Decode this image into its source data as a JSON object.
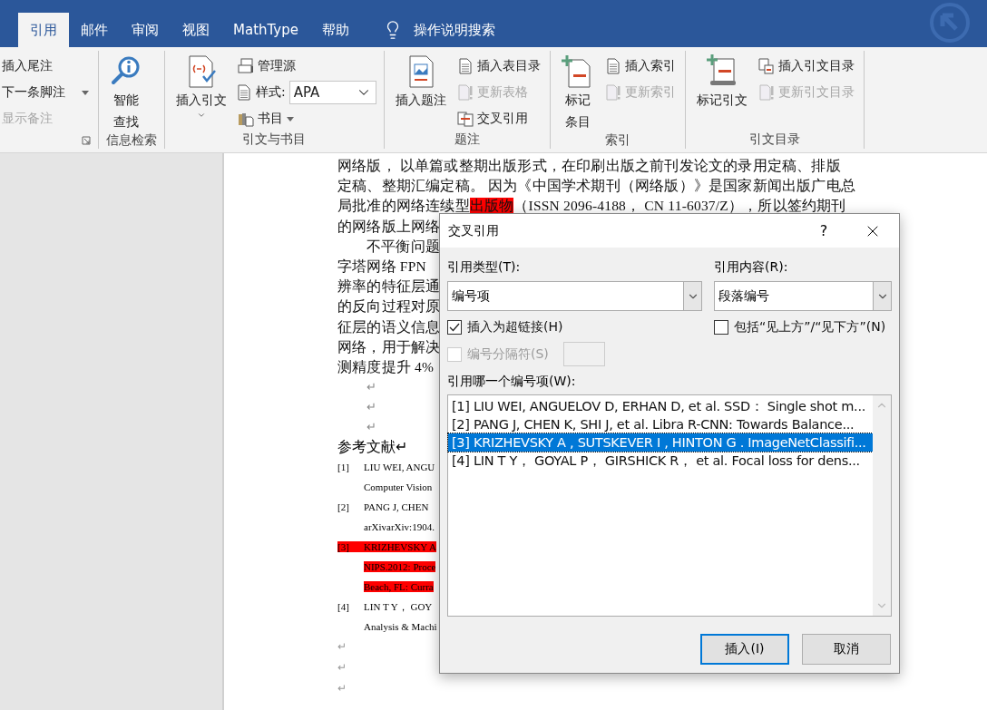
{
  "ribbon_tabs": [
    {
      "label": "引用",
      "selected": true
    },
    {
      "label": "邮件",
      "selected": false
    },
    {
      "label": "审阅",
      "selected": false
    },
    {
      "label": "视图",
      "selected": false
    },
    {
      "label": "MathType",
      "selected": false
    },
    {
      "label": "帮助",
      "selected": false
    }
  ],
  "tell_me": "操作说明搜索",
  "ribbon_groups": [
    {
      "launcher": true,
      "small": [
        {
          "kind": "button",
          "label": "插入尾注",
          "disabled": false
        },
        {
          "kind": "button",
          "label": "下一条脚注",
          "disabled": false,
          "dropdown": true
        },
        {
          "kind": "button",
          "label": "显示备注",
          "disabled": true
        }
      ]
    },
    {
      "label": "信息检索",
      "large": [
        {
          "lines": [
            "智能",
            "查找"
          ]
        }
      ]
    },
    {
      "label": "引文与书目",
      "large": [
        {
          "lines": [
            "插入引文"
          ],
          "dropdown": true
        }
      ],
      "small": [
        {
          "kind": "button",
          "label": "管理源",
          "disabled": false
        },
        {
          "kind": "combo",
          "label": "样式:",
          "value": "APA"
        },
        {
          "kind": "button",
          "label": "书目",
          "disabled": false,
          "dropdown": true
        }
      ]
    },
    {
      "label": "题注",
      "large": [
        {
          "lines": [
            "插入题注"
          ]
        }
      ],
      "small": [
        {
          "kind": "button",
          "label": "插入表目录",
          "disabled": false
        },
        {
          "kind": "button",
          "label": "更新表格",
          "disabled": true
        },
        {
          "kind": "button",
          "label": "交叉引用",
          "disabled": false
        }
      ]
    },
    {
      "label": "索引",
      "large": [
        {
          "lines": [
            "标记",
            "条目"
          ]
        }
      ],
      "small": [
        {
          "kind": "button",
          "label": "插入索引",
          "disabled": false
        },
        {
          "kind": "button",
          "label": "更新索引",
          "disabled": true
        }
      ]
    },
    {
      "label": "引文目录",
      "large": [
        {
          "lines": [
            "标记引文"
          ]
        }
      ],
      "small": [
        {
          "kind": "button",
          "label": "插入引文目录",
          "disabled": false
        },
        {
          "kind": "button",
          "label": "更新引文目录",
          "disabled": true
        }
      ]
    }
  ],
  "document": {
    "lines": [
      {
        "indent": false,
        "segments": [
          {
            "text": "网络版， 以单篇或整期出版形式，在印刷出版之前刊发论文的录用定稿、排版",
            "highlight": false
          }
        ]
      },
      {
        "indent": false,
        "segments": [
          {
            "text": "定稿、整期汇编定稿。 因为《中国学术期刊（网络版）》是国家新闻出版广电总",
            "highlight": false
          }
        ]
      },
      {
        "indent": false,
        "segments": [
          {
            "text": "局批准的网络连续型",
            "highlight": false
          },
          {
            "text": "出版物",
            "highlight": true
          },
          {
            "text": "（ISSN 2096-4188， CN 11-6037/Z），所以签约期刊",
            "highlight": false
          }
        ]
      },
      {
        "indent": false,
        "segments": [
          {
            "text": "的网络版上网络",
            "highlight": false
          }
        ]
      },
      {
        "indent": true,
        "segments": [
          {
            "text": "不平衡问题",
            "highlight": false
          }
        ]
      },
      {
        "indent": false,
        "segments": [
          {
            "text": "字塔网络 FPN",
            "highlight": false
          }
        ]
      },
      {
        "indent": false,
        "segments": [
          {
            "text": "辨率的特征层通",
            "highlight": false
          }
        ]
      },
      {
        "indent": false,
        "segments": [
          {
            "text": "的反向过程对原",
            "highlight": false
          }
        ]
      },
      {
        "indent": false,
        "segments": [
          {
            "text": "征层的语义信息",
            "highlight": false
          }
        ]
      },
      {
        "indent": false,
        "segments": [
          {
            "text": "网络，用于解决",
            "highlight": false
          }
        ]
      },
      {
        "indent": false,
        "segments": [
          {
            "text": "测精度提升 4%",
            "highlight": false
          }
        ]
      }
    ],
    "blank_marks": [
      "↵",
      "↵",
      "↵"
    ],
    "heading": "参考文献↵",
    "references": [
      {
        "number": "[1]",
        "lines": [
          "LIU WEI, ANGU",
          "Computer Vision"
        ],
        "highlight": false
      },
      {
        "number": "[2]",
        "lines": [
          "PANG J, CHEN",
          "arXivarXiv:1904."
        ],
        "highlight": false
      },
      {
        "number": "[3]",
        "lines": [
          "KRIZHEVSKY A",
          "NIPS.2012: Proce",
          "Beach, FL: Curra"
        ],
        "highlight": true
      },
      {
        "number": "[4]",
        "lines": [
          "LIN T Y， GOY",
          "Analysis & Machi"
        ],
        "highlight": false
      }
    ],
    "end_marks": [
      "↵",
      "↵",
      "↵"
    ]
  },
  "dialog": {
    "title": "交叉引用",
    "help": "?",
    "ref_type": {
      "label": "引用类型(T):",
      "value": "编号项"
    },
    "ref_content": {
      "label": "引用内容(R):",
      "value": "段落编号"
    },
    "checkboxes": [
      {
        "label": "插入为超链接(H)",
        "checked": true,
        "disabled": false
      },
      {
        "label": "包括“见上方”/“见下方”(N)",
        "checked": false,
        "disabled": false
      },
      {
        "label": "编号分隔符(S)",
        "checked": false,
        "disabled": true
      }
    ],
    "list_label": "引用哪一个编号项(W):",
    "items": [
      {
        "text": "[1] LIU WEI, ANGUELOV D, ERHAN D, et al. SSD：  Single shot m...",
        "selected": false
      },
      {
        "text": "[2] PANG J, CHEN K, SHI J, et al. Libra R-CNN: Towards Balance...",
        "selected": false
      },
      {
        "text": "[3] KRIZHEVSKY A , SUTSKEVER I , HINTON G . ImageNetClassifi...",
        "selected": true
      },
      {
        "text": "[4] LIN T Y，  GOYAL P，  GIRSHICK R，  et al. Focal loss for dens...",
        "selected": false
      }
    ],
    "buttons": [
      {
        "label": "插入(I)",
        "default": true
      },
      {
        "label": "取消",
        "default": false
      }
    ]
  }
}
